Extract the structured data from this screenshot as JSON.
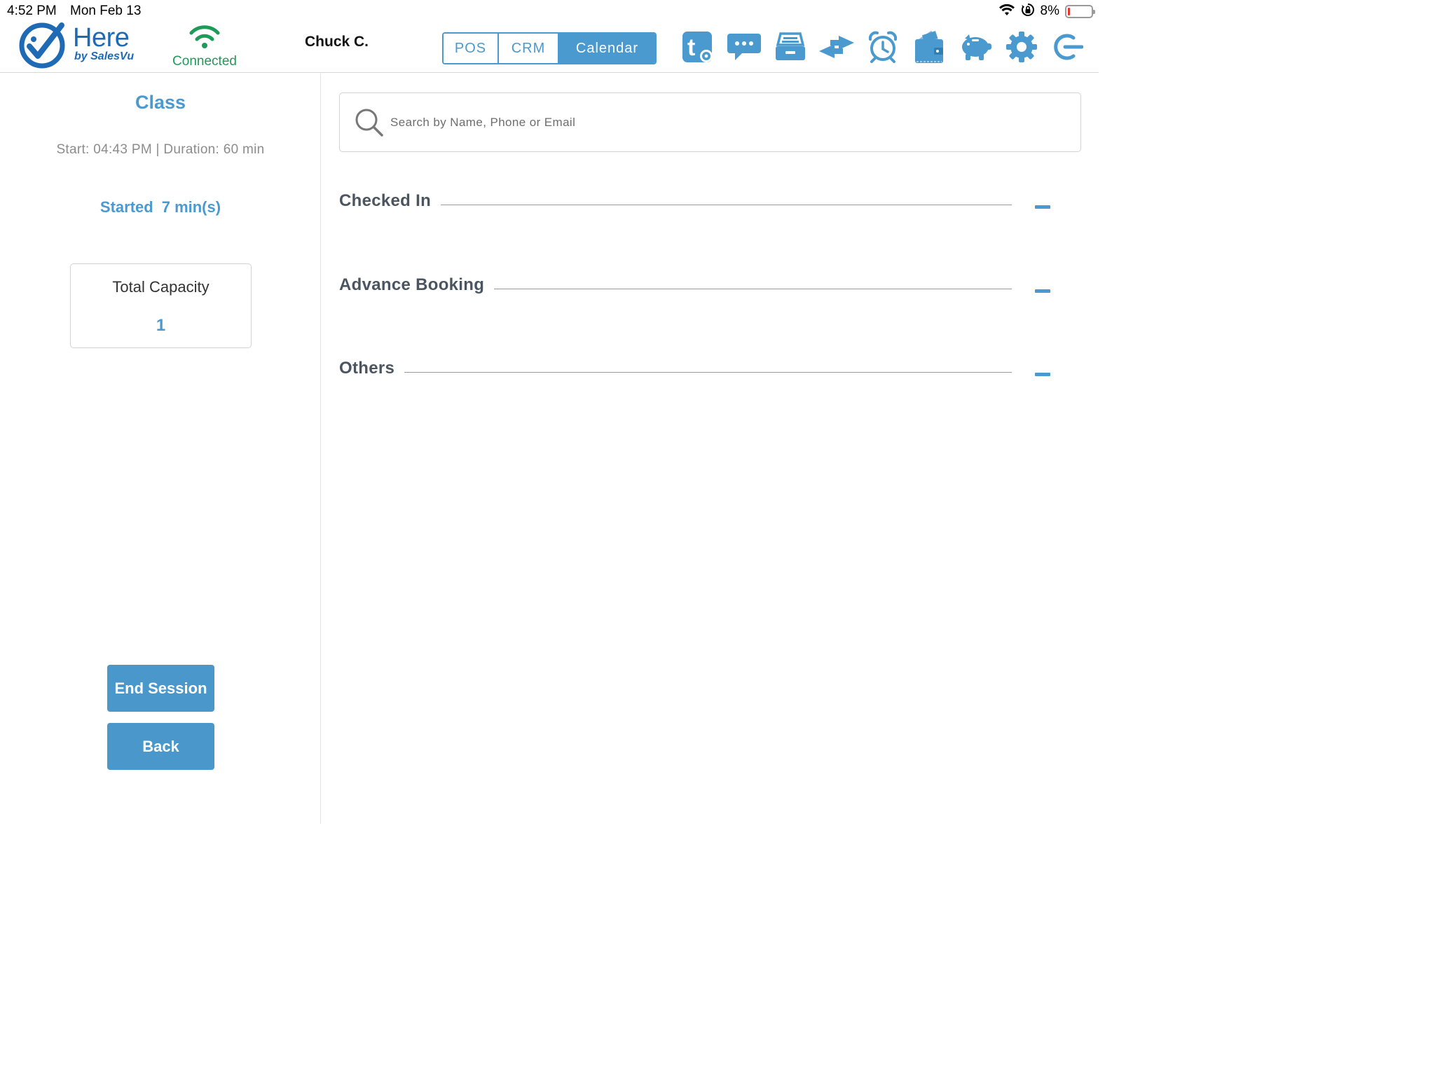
{
  "status_bar": {
    "time": "4:52 PM",
    "date": "Mon Feb 13",
    "battery_text": "8%",
    "battery_level": 0.08,
    "battery_color": "#e8362c"
  },
  "header": {
    "logo": {
      "name": "Here",
      "tagline": "by SalesVu"
    },
    "connection_status": "Connected",
    "user_name": "Chuck C.",
    "tabs": [
      {
        "label": "POS",
        "active": false
      },
      {
        "label": "CRM",
        "active": false
      },
      {
        "label": "Calendar",
        "active": true
      }
    ],
    "icons": [
      "tablet-settings-icon",
      "chat-icon",
      "cash-drawer-icon",
      "transfer-icon",
      "alarm-icon",
      "wallet-icon",
      "piggy-bank-icon",
      "gear-icon",
      "logout-icon"
    ]
  },
  "session": {
    "title": "Class",
    "meta": "Start: 04:43 PM | Duration: 60 min",
    "started_label": "Started",
    "started_value": "7 min(s)",
    "capacity_label": "Total Capacity",
    "capacity_value": "1",
    "end_button": "End Session",
    "back_button": "Back"
  },
  "search": {
    "placeholder": "Search by Name, Phone or Email",
    "value": ""
  },
  "sections": [
    {
      "title": "Checked In"
    },
    {
      "title": "Advance Booking"
    },
    {
      "title": "Others"
    }
  ],
  "colors": {
    "accent": "#4a9acf",
    "connected": "#1e9b58",
    "logo": "#1f6ab5"
  }
}
